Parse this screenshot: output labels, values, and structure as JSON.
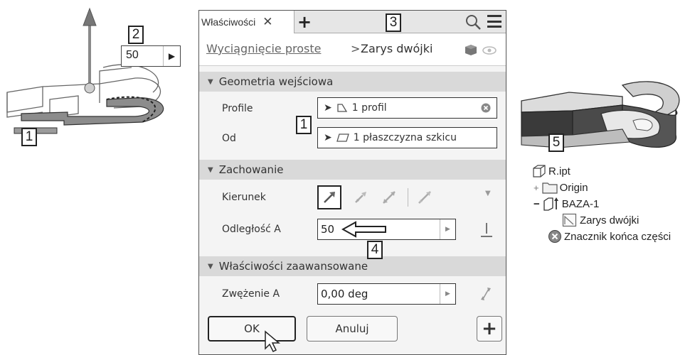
{
  "callouts": {
    "c1_left": "1",
    "c2": "2",
    "c3": "3",
    "c1_dialog": "1",
    "c4": "4",
    "c5": "5"
  },
  "mini_input": {
    "value": "50"
  },
  "dialog": {
    "tab_label": "Właściwości",
    "breadcrumb": {
      "parent": "Wyciągnięcie proste",
      "separator": ">",
      "current": "Zarys dwójki"
    },
    "sections": {
      "input_geometry": {
        "title": "Geometria wejściowa",
        "profile_label": "Profile",
        "profile_value": "1 profil",
        "from_label": "Od",
        "from_value": "1 płaszczyzna szkicu"
      },
      "behavior": {
        "title": "Zachowanie",
        "direction_label": "Kierunek",
        "distance_label": "Odległość A",
        "distance_value": "50"
      },
      "advanced": {
        "title": "Właściwości zaawansowane",
        "taper_label": "Zwężenie A",
        "taper_value": "0,00 deg"
      }
    },
    "buttons": {
      "ok": "OK",
      "cancel": "Anuluj",
      "plus": "+"
    }
  },
  "tree": {
    "items": [
      {
        "label": "R.ipt",
        "icon": "part-file-icon"
      },
      {
        "label": "Origin",
        "icon": "folder-icon"
      },
      {
        "label": "BAZA-1",
        "icon": "extrude-feature-icon"
      },
      {
        "label": "Zarys dwójki",
        "icon": "sketch-icon"
      },
      {
        "label": "Znacznik końca części",
        "icon": "end-of-part-icon"
      }
    ]
  },
  "colors": {
    "dialog_bg": "#f4f4f4",
    "section_header": "#d9d9d9",
    "accent": "#222222"
  }
}
